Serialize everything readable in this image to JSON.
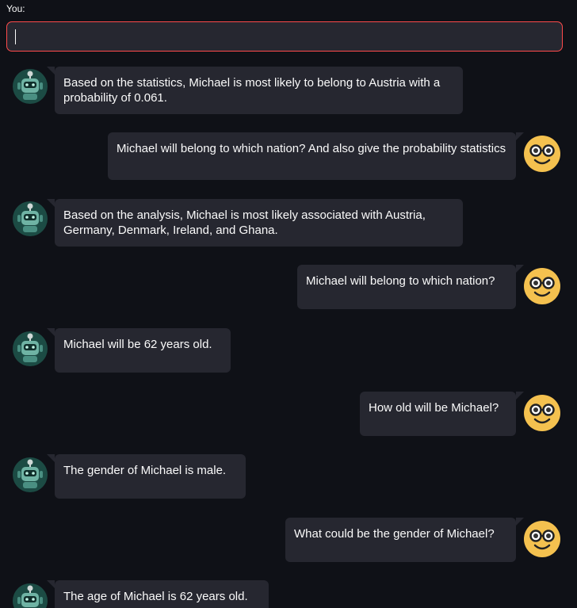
{
  "input": {
    "label": "You:",
    "value": "",
    "border_color": "#ff4b4b"
  },
  "avatars": {
    "bot": "robot-avatar-icon",
    "user": "glasses-smiley-avatar-icon"
  },
  "messages": [
    {
      "role": "bot",
      "text": "Based on the statistics, Michael is most likely to belong to Austria with a probability of 0.061."
    },
    {
      "role": "user",
      "text": "Michael will belong to which nation? And also give the probability statistics"
    },
    {
      "role": "bot",
      "text": "Based on the analysis, Michael is most likely associated with Austria, Germany, Denmark, Ireland, and Ghana."
    },
    {
      "role": "user",
      "text": "Michael will belong to which nation?"
    },
    {
      "role": "bot",
      "text": "Michael will be 62 years old."
    },
    {
      "role": "user",
      "text": "How old will be Michael?"
    },
    {
      "role": "bot",
      "text": "The gender of Michael is male."
    },
    {
      "role": "user",
      "text": "What could be the gender of Michael?"
    },
    {
      "role": "bot",
      "text": "The age of Michael is 62 years old."
    }
  ]
}
